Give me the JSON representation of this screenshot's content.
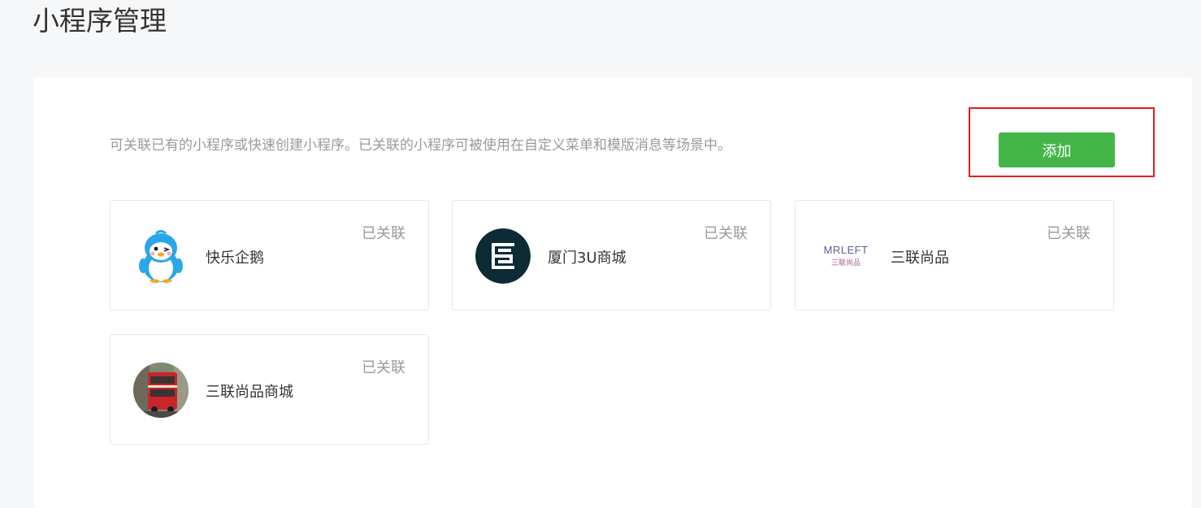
{
  "page": {
    "title": "小程序管理"
  },
  "panel": {
    "description": "可关联已有的小程序或快速创建小程序。已关联的小程序可被使用在自定义菜单和模版消息等场景中。",
    "add_label": "添加"
  },
  "colors": {
    "accent": "#44b549",
    "highlight": "#e11d1d"
  },
  "cards": [
    {
      "name": "快乐企鹅",
      "status": "已关联",
      "icon": "penguin-icon"
    },
    {
      "name": "厦门3U商城",
      "status": "已关联",
      "icon": "3u-logo-icon"
    },
    {
      "name": "三联尚品",
      "status": "已关联",
      "icon": "mrleft-logo",
      "logo_text": "MRLEFT",
      "logo_subtext": "三联尚品"
    },
    {
      "name": "三联尚品商城",
      "status": "已关联",
      "icon": "red-bus-photo"
    }
  ]
}
